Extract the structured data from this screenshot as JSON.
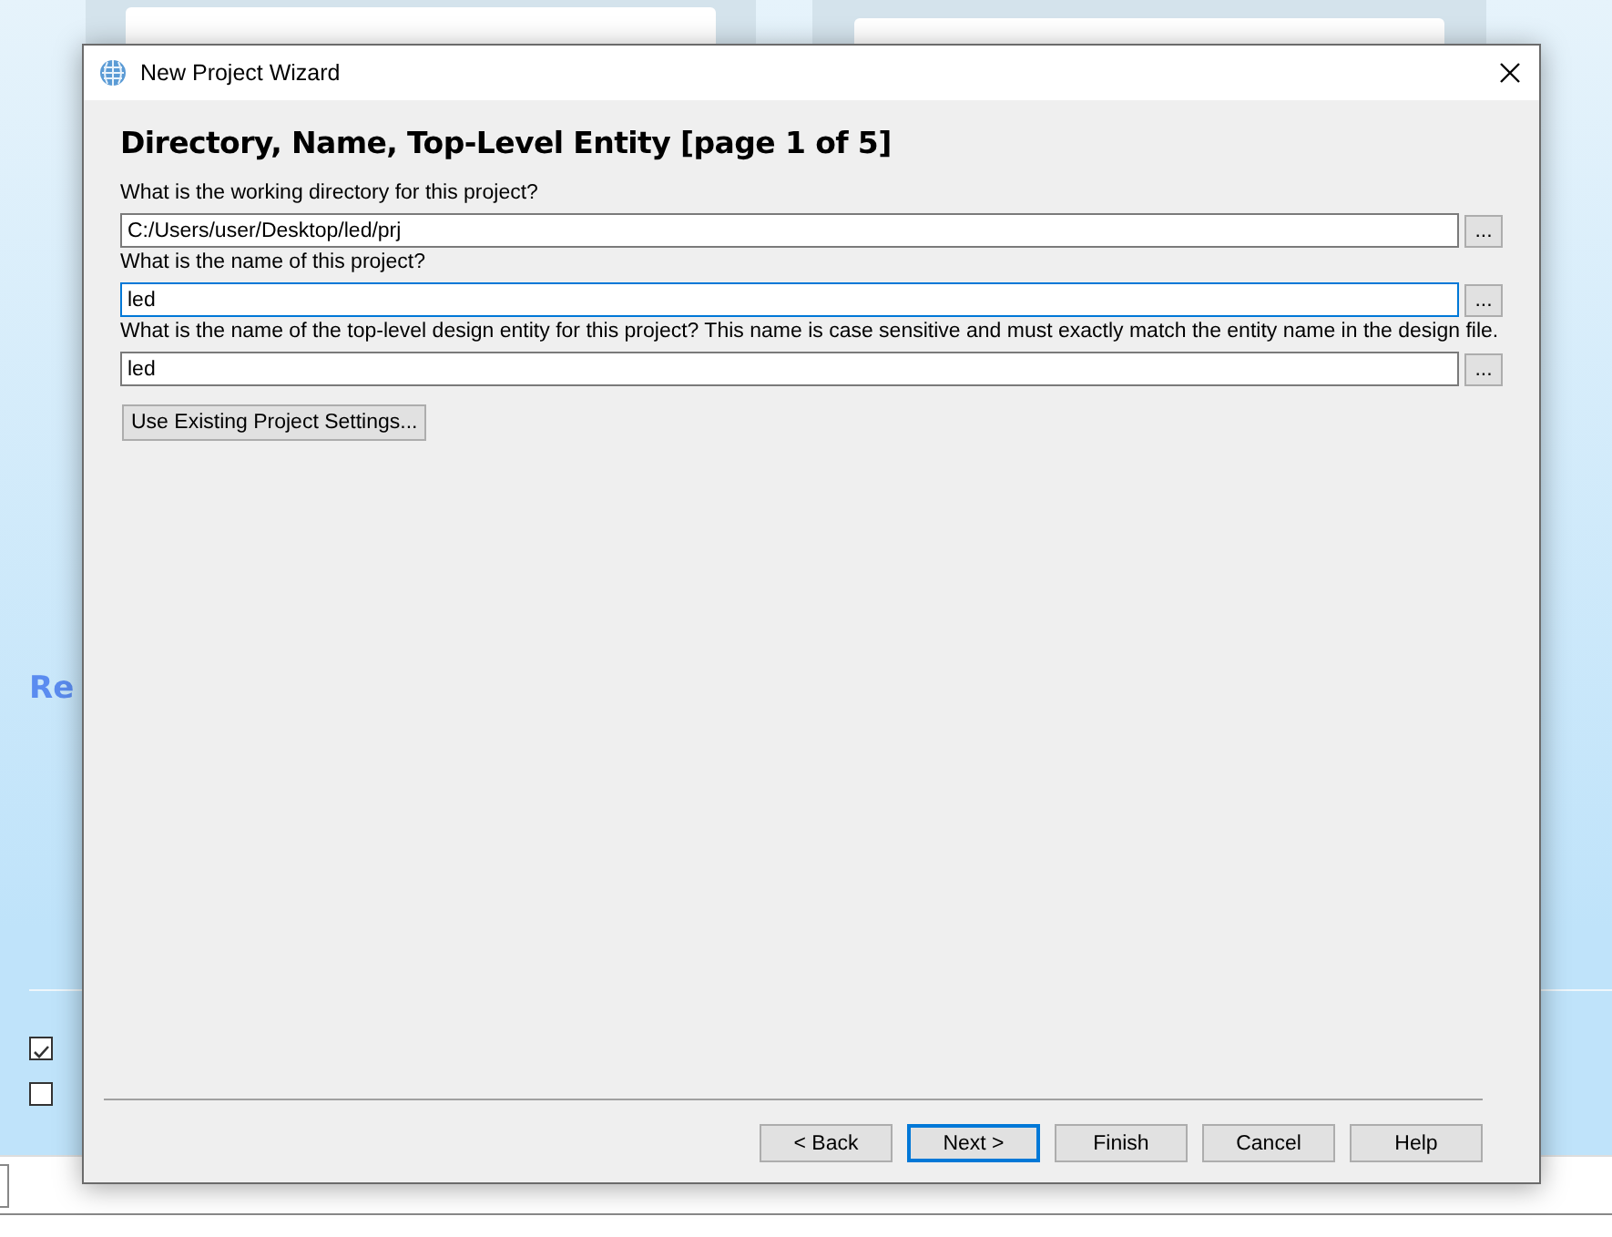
{
  "background": {
    "heading": "Re",
    "checkboxes": [
      {
        "checked": true
      },
      {
        "checked": false
      }
    ]
  },
  "window": {
    "title": "New Project Wizard"
  },
  "page_title": "Directory, Name, Top-Level Entity [page 1 of 5]",
  "fields": [
    {
      "label": "What is the working directory for this project?",
      "value": "C:/Users/user/Desktop/led/prj",
      "focused": false,
      "browse": "..."
    },
    {
      "label": "What is the name of this project?",
      "value": "led",
      "focused": true,
      "browse": "..."
    },
    {
      "label": "What is the name of the top-level design entity for this project? This name is case sensitive and must exactly match the entity name in the design file.",
      "value": "led",
      "focused": false,
      "browse": "..."
    }
  ],
  "settings_button": "Use Existing Project Settings...",
  "buttons": [
    {
      "label": "< Back",
      "default": false
    },
    {
      "label": "Next >",
      "default": true
    },
    {
      "label": "Finish",
      "default": false
    },
    {
      "label": "Cancel",
      "default": false
    },
    {
      "label": "Help",
      "default": false
    }
  ]
}
